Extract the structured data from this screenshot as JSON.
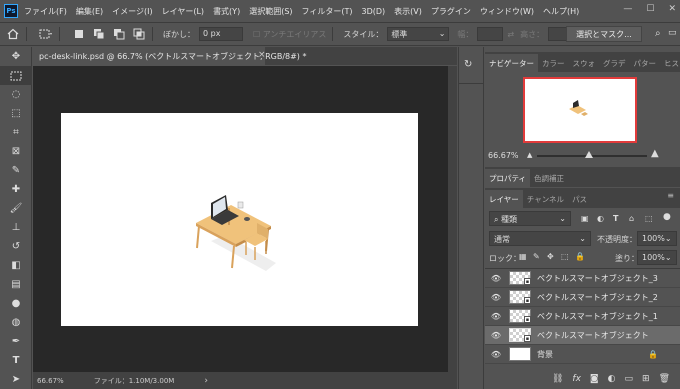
{
  "app": {
    "logo": "Ps"
  },
  "menu": [
    "ファイル(F)",
    "編集(E)",
    "イメージ(I)",
    "レイヤー(L)",
    "書式(Y)",
    "選択範囲(S)",
    "フィルター(T)",
    "3D(D)",
    "表示(V)",
    "プラグイン",
    "ウィンドウ(W)",
    "ヘルプ(H)"
  ],
  "window_controls": [
    "—",
    "☐",
    "✕"
  ],
  "options": {
    "feather_label": "ぼかし：",
    "feather_value": "0 px",
    "antialias_label": "アンチエイリアス",
    "style_label": "スタイル：",
    "style_value": "標準",
    "width_label": "幅：",
    "height_label": "高さ：",
    "select_mask_label": "選択とマスク..."
  },
  "document": {
    "tab_title": "pc-desk-link.psd @ 66.7% (ベクトルスマートオブジェクト, RGB/8#) *",
    "close_icon": "×",
    "zoom": "66.67%",
    "file_info": "ファイル：1.10M/3.00M",
    "status_arrow": "›"
  },
  "navigator": {
    "tabs": [
      "ナビゲーター",
      "カラー",
      "スウォ",
      "グラデ",
      "パター",
      "ヒストリ"
    ],
    "zoom": "66.67%"
  },
  "properties": {
    "tabs": [
      "プロパティ",
      "色調補正"
    ]
  },
  "layers_panel": {
    "tabs": [
      "レイヤー",
      "チャンネル",
      "パス"
    ],
    "filter_kind": "種類",
    "blend_mode": "通常",
    "opacity_label": "不透明度：",
    "opacity_value": "100%",
    "lock_label": "ロック：",
    "fill_label": "塗り：",
    "fill_value": "100%",
    "layers": [
      {
        "name": "ベクトルスマートオブジェクト_3",
        "visible": true,
        "selected": false
      },
      {
        "name": "ベクトルスマートオブジェクト_2",
        "visible": true,
        "selected": false
      },
      {
        "name": "ベクトルスマートオブジェクト_1",
        "visible": true,
        "selected": false
      },
      {
        "name": "ベクトルスマートオブジェクト",
        "visible": true,
        "selected": true
      },
      {
        "name": "背景",
        "visible": true,
        "selected": false,
        "locked": true
      }
    ],
    "bottom_icons": [
      "link-icon",
      "fx-icon",
      "mask-icon",
      "adjustment-icon",
      "folder-icon",
      "new-layer-icon",
      "trash-icon"
    ]
  },
  "colors": {
    "ui_bg": "#535353",
    "canvas_bg": "#282828",
    "document": "#ffffff",
    "navigator_frame": "#e23b3b",
    "ps_blue": "#31a8ff"
  }
}
